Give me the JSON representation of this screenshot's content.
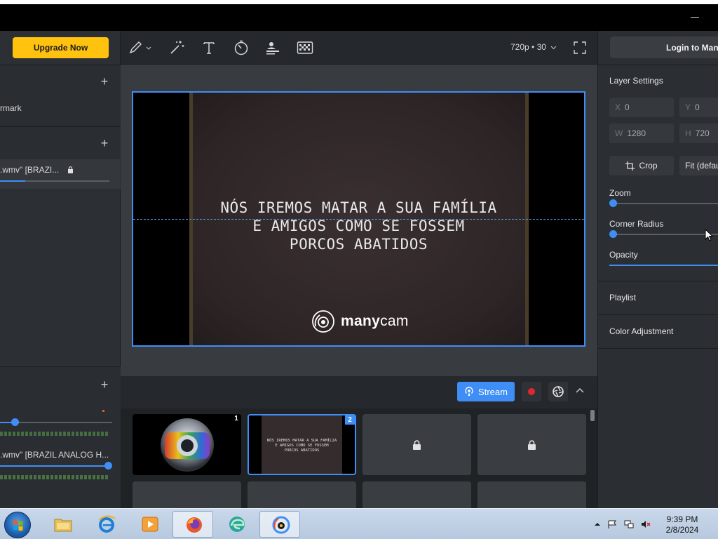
{
  "app": {
    "minimize_icon": "minimize-icon"
  },
  "left_panel": {
    "upgrade_label": "Upgrade Now",
    "section1": {
      "item_label": "rmark"
    },
    "section2": {
      "item_label": ".wmv\" [BRAZI..."
    },
    "audio": {
      "item_label": ".wmv\" [BRAZIL ANALOG H..."
    }
  },
  "toolbar": {
    "tools": [
      "pen-icon",
      "magic-wand-icon",
      "text-icon",
      "timer-icon",
      "lower-thirds-icon",
      "chroma-key-icon"
    ],
    "resolution": "720p • 30",
    "fullscreen_icon": "fullscreen-icon"
  },
  "preview": {
    "overlay_lines": [
      "NÓS IREMOS MATAR A SUA FAMÍLIA",
      "E AMIGOS COMO SE FOSSEM",
      "PORCOS ABATIDOS"
    ],
    "watermark_bold": "many",
    "watermark_light": "cam"
  },
  "controls": {
    "stream_label": "Stream"
  },
  "scenes": [
    {
      "number": "1",
      "kind": "logo"
    },
    {
      "number": "2",
      "kind": "text",
      "lines": [
        "NÓS IREMOS MATAR A SUA FAMÍLIA",
        "E AMIGOS COMO SE FOSSEM",
        "PORCOS ABATIDOS"
      ]
    },
    {
      "number": "",
      "kind": "locked"
    },
    {
      "number": "",
      "kind": "locked"
    }
  ],
  "right_panel": {
    "login_label": "Login to Many",
    "layer_settings_title": "Layer Settings",
    "x_label": "X",
    "x_value": "0",
    "y_label": "Y",
    "y_value": "0",
    "w_label": "W",
    "w_value": "1280",
    "h_label": "H",
    "h_value": "720",
    "crop_label": "Crop",
    "fit_label": "Fit (defau",
    "zoom_label": "Zoom",
    "zoom_value": 0,
    "corner_radius_label": "Corner Radius",
    "corner_radius_value": 0,
    "opacity_label": "Opacity",
    "opacity_value": 1,
    "playlist_label": "Playlist",
    "color_adjustment_label": "Color Adjustment"
  },
  "taskbar": {
    "apps": [
      "file-explorer-icon",
      "internet-explorer-icon",
      "media-player-icon",
      "firefox-icon",
      "edge-icon",
      "manycam-icon"
    ],
    "time": "9:39 PM",
    "date": "2/8/2024"
  },
  "colors": {
    "accent": "#3f8ef5",
    "upgrade": "#ffc20e",
    "record": "#e3262f"
  }
}
